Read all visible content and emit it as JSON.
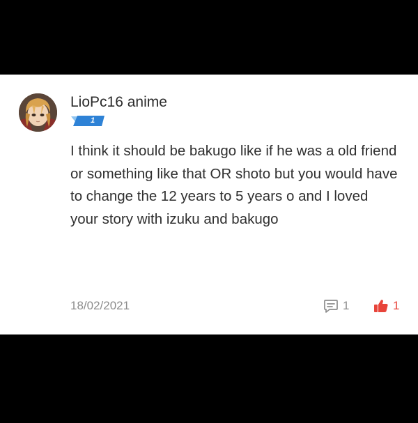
{
  "comment": {
    "username": "LioPc16 anime",
    "level": "1",
    "avatar_icon": "anime-avatar",
    "text": "I think it should be bakugo like if he was a old friend or something like that OR shoto but you would have to change the 12 years to 5 years o and I loved your story with izuku and bakugo",
    "date": "18/02/2021",
    "reply_icon": "comment-icon",
    "reply_count": "1",
    "like_icon": "thumbs-up-icon",
    "like_count": "1"
  },
  "colors": {
    "level_badge": "#2e82d6",
    "like_accent": "#e8443a",
    "secondary_text": "#8c8c8c"
  }
}
